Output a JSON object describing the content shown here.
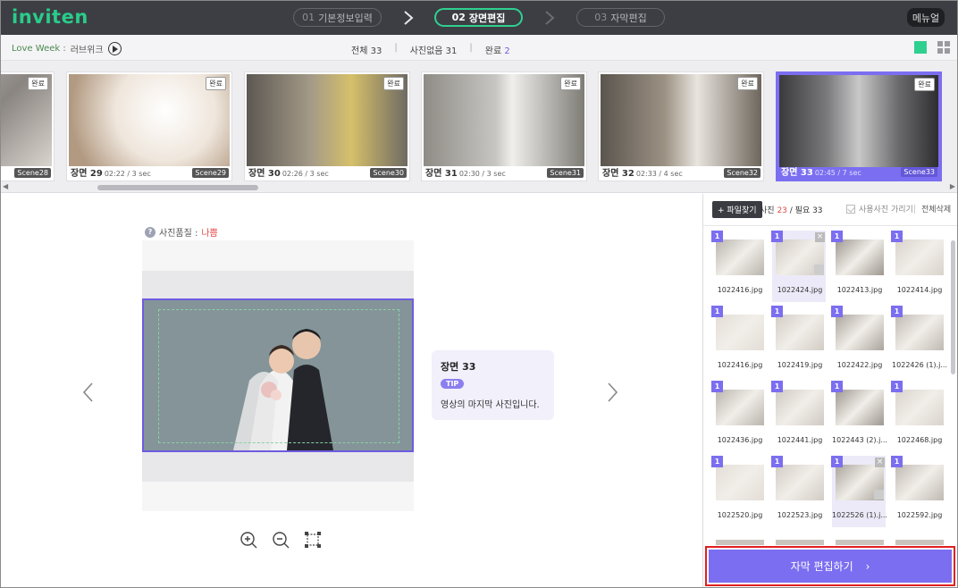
{
  "header": {
    "logo": "inviten",
    "steps": [
      {
        "num": "01",
        "label": "기본정보입력"
      },
      {
        "num": "02",
        "label": "장면편집"
      },
      {
        "num": "03",
        "label": "자막편집"
      }
    ],
    "menu_label": "메뉴얼"
  },
  "statusbar": {
    "story": "Love Week :",
    "project": "러브위크",
    "total": "전체 33",
    "no_photo": "사진없음 31",
    "done_label": "완료",
    "done_count": "2"
  },
  "scenes": [
    {
      "title": "",
      "time": "",
      "tag": "Scene28",
      "badge": "완료"
    },
    {
      "title": "장면 29",
      "time": "02:22 / 3 sec",
      "tag": "Scene29",
      "badge": "완료"
    },
    {
      "title": "장면 30",
      "time": "02:26 / 3 sec",
      "tag": "Scene30",
      "badge": "완료"
    },
    {
      "title": "장면 31",
      "time": "02:30 / 3 sec",
      "tag": "Scene31",
      "badge": "완료"
    },
    {
      "title": "장면 32",
      "time": "02:33 / 4 sec",
      "tag": "Scene32",
      "badge": "완료"
    },
    {
      "title": "장면 33",
      "time": "02:45 / 7 sec",
      "tag": "Scene33",
      "badge": "완료"
    }
  ],
  "editor": {
    "quality_label": "사진품질 :",
    "quality_value": "나쁨",
    "tip_title": "장면 33",
    "tip_badge": "TIP",
    "tip_text": "영상의 마지막 사진입니다."
  },
  "panel": {
    "find_button": "+ 파일찾기",
    "photo_label": "사진",
    "photo_count": "23",
    "required": "/ 필요 33",
    "hide_used": "사용사진 가리기",
    "delete_all": "전체삭제",
    "photos": [
      {
        "num": "1",
        "name": "1022416.jpg"
      },
      {
        "num": "1",
        "name": "1022424.jpg"
      },
      {
        "num": "1",
        "name": "1022413.jpg"
      },
      {
        "num": "1",
        "name": "1022414.jpg"
      },
      {
        "num": "1",
        "name": "1022416.jpg"
      },
      {
        "num": "1",
        "name": "1022419.jpg"
      },
      {
        "num": "1",
        "name": "1022422.jpg"
      },
      {
        "num": "1",
        "name": "1022426 (1).j..."
      },
      {
        "num": "1",
        "name": "1022436.jpg"
      },
      {
        "num": "1",
        "name": "1022441.jpg"
      },
      {
        "num": "1",
        "name": "1022443 (2).j..."
      },
      {
        "num": "1",
        "name": "1022468.jpg"
      },
      {
        "num": "1",
        "name": "1022520.jpg"
      },
      {
        "num": "1",
        "name": "1022523.jpg"
      },
      {
        "num": "1",
        "name": "1022526 (1).j..."
      },
      {
        "num": "1",
        "name": "1022592.jpg"
      }
    ],
    "cta_label": "자막 편집하기",
    "cta_arrow": "›"
  },
  "colors": {
    "brand_green": "#2fd08f",
    "accent_purple": "#7b6ef0",
    "highlight_red": "#e02020"
  }
}
